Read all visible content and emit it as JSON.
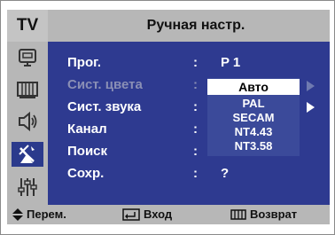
{
  "header": {
    "tv_label": "TV",
    "title": "Ручная настр."
  },
  "sidebar": {
    "icons": [
      "input-icon",
      "picture-icon",
      "sound-icon",
      "channel-icon",
      "setup-icon"
    ],
    "active": "channel-icon"
  },
  "menu": {
    "items": [
      {
        "label": "Прог.",
        "value": "P 1",
        "enabled": true
      },
      {
        "label": "Сист. цвета",
        "value": "",
        "enabled": false
      },
      {
        "label": "Сист. звука",
        "value": "",
        "enabled": true
      },
      {
        "label": "Канал",
        "value": "",
        "enabled": true
      },
      {
        "label": "Поиск",
        "value": "",
        "enabled": true
      },
      {
        "label": "Сохр.",
        "value": "?",
        "enabled": true
      }
    ],
    "separator": ":"
  },
  "dropdown": {
    "options": [
      "Авто",
      "PAL",
      "SECAM",
      "NT4.43",
      "NT3.58"
    ],
    "selected": "Авто"
  },
  "footer": {
    "move_label": "Перем.",
    "enter_label": "Вход",
    "return_label": "Возврат"
  },
  "colors": {
    "menu_bg": "#2e3a90",
    "panel_gray": "#b7b7b7",
    "disabled_text": "#8a8fb5"
  }
}
